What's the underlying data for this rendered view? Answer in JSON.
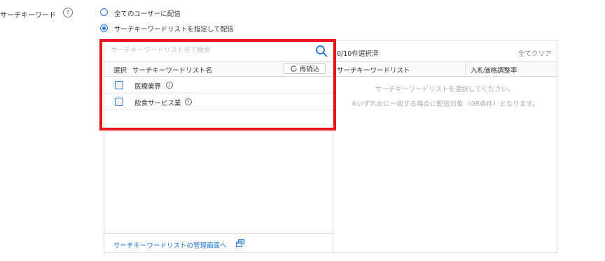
{
  "field": {
    "label": "サーチキーワード",
    "help": "?"
  },
  "radios": [
    {
      "label": "全てのユーザーに配信",
      "checked": false
    },
    {
      "label": "サーチキーワードリストを指定して配信",
      "checked": true
    }
  ],
  "left": {
    "search_placeholder": "サーチキーワードリスト名で検索",
    "col_select": "選択",
    "col_name": "サーチキーワードリスト名",
    "reload_label": "再読込",
    "rows": [
      {
        "label": "医療業界",
        "checked": false
      },
      {
        "label": "飲食サービス業",
        "checked": false
      }
    ],
    "manage_link": "サーチキーワードリストの管理画面へ"
  },
  "right": {
    "selected_count": "0/10件選択済",
    "clear_all": "全てクリア",
    "col_list": "サーチキーワードリスト",
    "col_rate": "入札価格調整率",
    "empty_line1": "サーチキーワードリストを選択してください。",
    "empty_line2": "※いずれかに一致する場合に配信対象（OR条件）となります。"
  },
  "colors": {
    "accent": "#1a73e8",
    "highlight": "#e8151c",
    "border": "#dcdcdc"
  }
}
